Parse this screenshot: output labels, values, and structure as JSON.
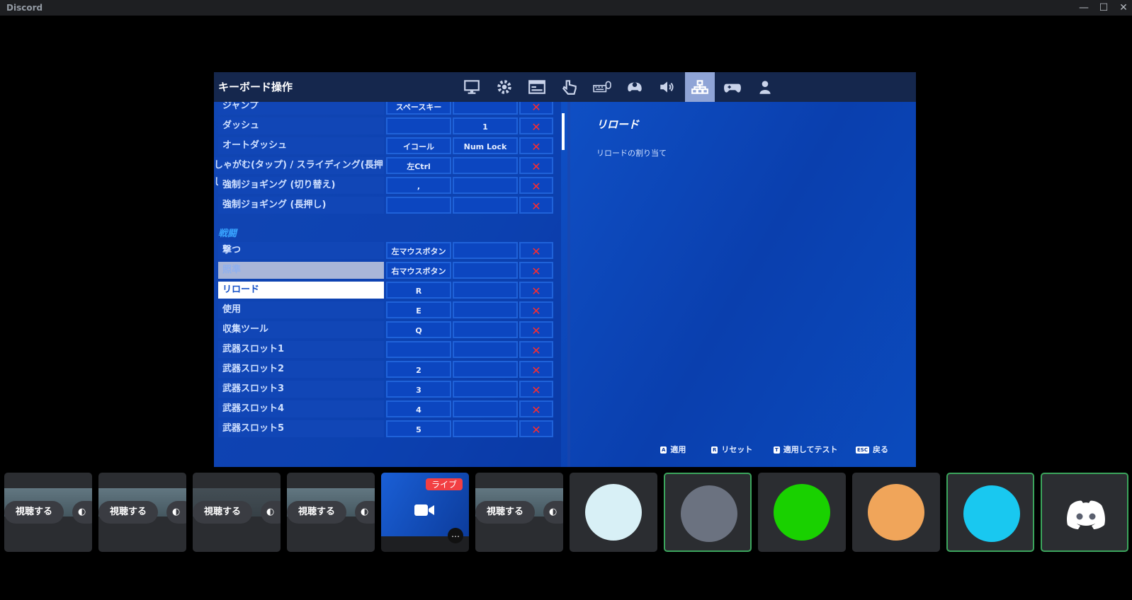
{
  "window": {
    "app_title": "Discord",
    "minimize": "—",
    "maximize": "☐",
    "close": "✕"
  },
  "game": {
    "title": "キーボード操作",
    "tabs": [
      "monitor-icon",
      "gear-icon",
      "display-icon",
      "touch-icon",
      "keyboard-mouse-icon",
      "controller-settings-icon",
      "speaker-icon",
      "network-icon",
      "gamepad-icon",
      "user-icon"
    ],
    "active_tab_index": 7,
    "rows_top": [
      {
        "label": "ジャンプ",
        "key1": "スペースキー",
        "key2": "",
        "x": "✕"
      },
      {
        "label": "ダッシュ",
        "key1": "",
        "key2": "1",
        "x": "✕"
      },
      {
        "label": "オートダッシュ",
        "key1": "イコール",
        "key2": "Num Lock",
        "x": "✕"
      },
      {
        "label": "しゃがむ(タップ) / スライディング(長押し)",
        "key1": "左Ctrl",
        "key2": "",
        "x": "✕"
      },
      {
        "label": "強制ジョギング (切り替え)",
        "key1": ",",
        "key2": "",
        "x": "✕"
      },
      {
        "label": "強制ジョギング (長押し)",
        "key1": "",
        "key2": "",
        "x": "✕"
      }
    ],
    "section_label": "戦闘",
    "rows_combat": [
      {
        "label": "撃つ",
        "key1": "左マウスボタン",
        "key2": "",
        "x": "✕"
      },
      {
        "label": "照準",
        "key1": "右マウスボタン",
        "key2": "",
        "x": "✕"
      },
      {
        "label": "リロード",
        "key1": "R",
        "key2": "",
        "x": "✕"
      },
      {
        "label": "使用",
        "key1": "E",
        "key2": "",
        "x": "✕"
      },
      {
        "label": "収集ツール",
        "key1": "Q",
        "key2": "",
        "x": "✕"
      },
      {
        "label": "武器スロット1",
        "key1": "",
        "key2": "",
        "x": "✕"
      },
      {
        "label": "武器スロット2",
        "key1": "2",
        "key2": "",
        "x": "✕"
      },
      {
        "label": "武器スロット3",
        "key1": "3",
        "key2": "",
        "x": "✕"
      },
      {
        "label": "武器スロット4",
        "key1": "4",
        "key2": "",
        "x": "✕"
      },
      {
        "label": "武器スロット5",
        "key1": "5",
        "key2": "",
        "x": "✕"
      }
    ],
    "detail": {
      "title": "リロード",
      "description": "リロードの割り当て"
    },
    "hints": [
      {
        "key": "A",
        "label": "適用"
      },
      {
        "key": "R",
        "label": "リセット"
      },
      {
        "key": "T",
        "label": "適用してテスト"
      },
      {
        "key": "ESC",
        "label": "戻る"
      }
    ]
  },
  "tiles": {
    "watch_label": "視聴する",
    "live_label": "ライブ",
    "avatar_colors": [
      "#a8e6f0",
      "#444a57",
      "#22e400",
      "#d58a66",
      "#1fb8e4",
      "#5865f2"
    ]
  }
}
